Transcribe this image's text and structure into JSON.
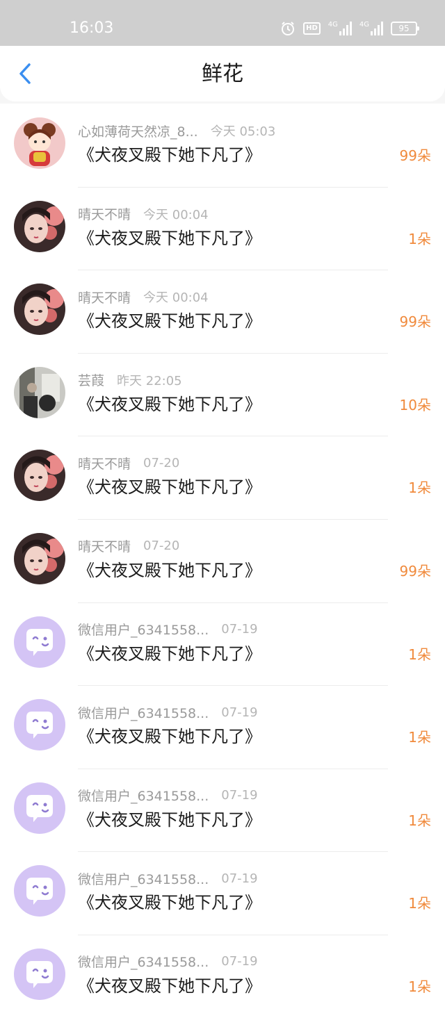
{
  "status_bar": {
    "time": "16:03",
    "hd_label": "HD",
    "network_1": "4G",
    "network_2": "4G",
    "battery": "95",
    "icons": [
      "alarm-icon",
      "hd-icon",
      "signal-icon",
      "signal-icon",
      "battery-icon"
    ]
  },
  "header": {
    "title": "鲜花",
    "back_icon": "chevron-left-icon",
    "accent_color": "#3a8ef0"
  },
  "colors": {
    "count": "#f08a3c",
    "default_avatar_bg": "#d4c4f5"
  },
  "items": [
    {
      "user": "心如薄荷天然凉_8...",
      "time": "今天 05:03",
      "book": "《犬夜叉殿下她下凡了》",
      "count": "99朵",
      "avatar": "avatar-girl-cartoon"
    },
    {
      "user": "晴天不晴",
      "time": "今天 00:04",
      "book": "《犬夜叉殿下她下凡了》",
      "count": "1朵",
      "avatar": "avatar-girl-portrait"
    },
    {
      "user": "晴天不晴",
      "time": "今天 00:04",
      "book": "《犬夜叉殿下她下凡了》",
      "count": "99朵",
      "avatar": "avatar-girl-portrait"
    },
    {
      "user": "芸葭",
      "time": "昨天 22:05",
      "book": "《犬夜叉殿下她下凡了》",
      "count": "10朵",
      "avatar": "avatar-photo"
    },
    {
      "user": "晴天不晴",
      "time": "07-20",
      "book": "《犬夜叉殿下她下凡了》",
      "count": "1朵",
      "avatar": "avatar-girl-portrait"
    },
    {
      "user": "晴天不晴",
      "time": "07-20",
      "book": "《犬夜叉殿下她下凡了》",
      "count": "99朵",
      "avatar": "avatar-girl-portrait"
    },
    {
      "user": "微信用户_6341558...",
      "time": "07-19",
      "book": "《犬夜叉殿下她下凡了》",
      "count": "1朵",
      "avatar": "avatar-default"
    },
    {
      "user": "微信用户_6341558...",
      "time": "07-19",
      "book": "《犬夜叉殿下她下凡了》",
      "count": "1朵",
      "avatar": "avatar-default"
    },
    {
      "user": "微信用户_6341558...",
      "time": "07-19",
      "book": "《犬夜叉殿下她下凡了》",
      "count": "1朵",
      "avatar": "avatar-default"
    },
    {
      "user": "微信用户_6341558...",
      "time": "07-19",
      "book": "《犬夜叉殿下她下凡了》",
      "count": "1朵",
      "avatar": "avatar-default"
    },
    {
      "user": "微信用户_6341558...",
      "time": "07-19",
      "book": "《犬夜叉殿下她下凡了》",
      "count": "1朵",
      "avatar": "avatar-default"
    }
  ]
}
